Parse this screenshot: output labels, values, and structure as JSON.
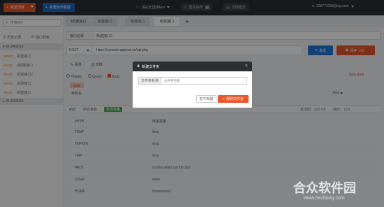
{
  "topbar": {
    "new_label": "新建项目",
    "collab_label": "新建协作数据",
    "env_label": "请在此选择Env",
    "btn1_label": "团队协作",
    "btn1_badge": "0",
    "btn2_label": "文档模式",
    "user_label": "325773298@qq.com"
  },
  "sidebar": {
    "search_placeholder": "搜索API",
    "tab_history": "历史记录",
    "tab_interfaces": "接口列表",
    "group1_date": "01/24/2019",
    "group2_date": "01/23/2019",
    "items": [
      {
        "method": "POST",
        "name": "新建接口"
      },
      {
        "method": "POST",
        "name": "4新建接口"
      },
      {
        "method": "POST",
        "name": "新建接口2"
      },
      {
        "method": "POST",
        "name": "新建接口"
      },
      {
        "method": "POST",
        "name": "新建接口"
      }
    ]
  },
  "tabs": [
    "4新建接口",
    "新建接口",
    "新建接口",
    "新建接口"
  ],
  "request": {
    "name_label": "接口名称",
    "name_value": "新建接口2",
    "method": "POST",
    "url": "https://console.apipost.cn/api.php",
    "send_label": "发送",
    "save_label": "保存（S）",
    "subtabs": [
      "请求",
      "文档"
    ],
    "body_opts": [
      "Header",
      "Query",
      "Body"
    ],
    "form_data": "form-data",
    "body_tag": "Body",
    "params_label": "参数名",
    "text_select": "Text"
  },
  "response": {
    "tabs": [
      "响应",
      "响应参数",
      "全局变量"
    ],
    "status": "状态码：200 OK",
    "time": "耗时：1ms",
    "col1": "server",
    "col2": "环境变量",
    "rows": [
      {
        "k": "TEMP",
        "v": "/tmp"
      },
      {
        "k": "TMPDIR",
        "v": "/tmp"
      },
      {
        "k": "TMP",
        "v": "/tmp"
      },
      {
        "k": "PATH",
        "v": "/usr/local/bin:/usr/bin:/bin"
      },
      {
        "k": "USER",
        "v": "www"
      },
      {
        "k": "HOME",
        "v": "/home/www"
      }
    ]
  },
  "modal": {
    "title": "新建文件夹",
    "field_label": "文件夹名称",
    "field_placeholder": "文件夹名称",
    "cancel_label": "暂不新建",
    "save_label": "保存文件夹"
  },
  "watermark": {
    "title": "合众软件园",
    "url": "www.hezhong.com"
  }
}
